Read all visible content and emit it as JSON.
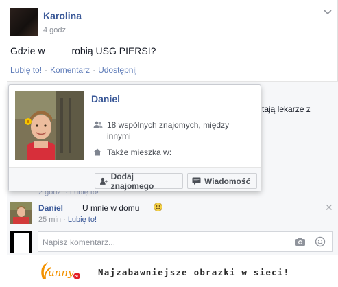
{
  "post": {
    "author": "Karolina",
    "time": "4 godz.",
    "text_before": "Gdzie w",
    "text_after": "robią USG PIERSI?",
    "actions": {
      "like": "Lubię to!",
      "comment": "Komentarz",
      "share": "Udostępnij"
    }
  },
  "background_comment_fragment": "tają lekarze z",
  "faded_row": "2 godz. · Lubię to!",
  "hovercard": {
    "name": "Daniel",
    "mutual_text": "18 wspólnych znajomych, między",
    "mutual_text_2": "innymi",
    "lives_text": "Także mieszka w:",
    "add_friend_label": "Dodaj znajomego",
    "message_label": "Wiadomość"
  },
  "comment": {
    "author": "Daniel",
    "text": "U mnie w domu",
    "time": "25 min",
    "like": "Lubię to!"
  },
  "write_comment": {
    "placeholder": "Napisz komentarz..."
  },
  "banner": {
    "logo_text": "Funny.pl",
    "tagline": "Najzabawniejsze obrazki w sieci!"
  },
  "colors": {
    "link_blue": "#3b5998",
    "logo_orange": "#f39200"
  },
  "icons": [
    "chevron-down-icon",
    "friends-icon",
    "home-icon",
    "add-friend-icon",
    "message-icon",
    "smiley-icon",
    "close-icon",
    "camera-icon",
    "emoji-icon"
  ]
}
